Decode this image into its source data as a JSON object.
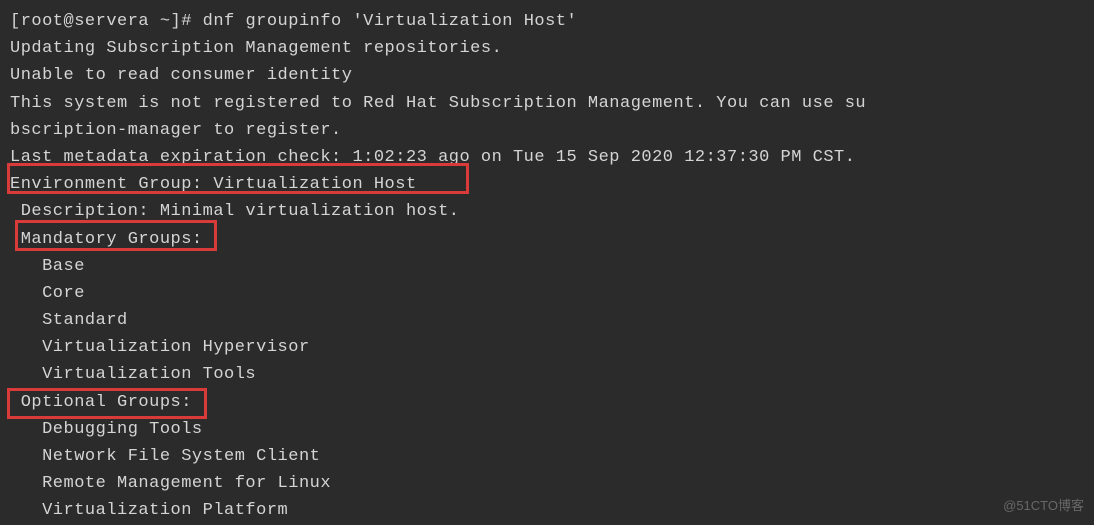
{
  "prompt": {
    "user_host": "[root@servera ~]#",
    "command": " dnf groupinfo 'Virtualization Host'"
  },
  "output": {
    "line1": "Updating Subscription Management repositories.",
    "line2": "Unable to read consumer identity",
    "line3": "This system is not registered to Red Hat Subscription Management. You can use su",
    "line4": "bscription-manager to register.",
    "line5": "Last metadata expiration check: 1:02:23 ago on Tue 15 Sep 2020 12:37:30 PM CST.",
    "env_group": "Environment Group: Virtualization Host",
    "description": " Description: Minimal virtualization host.",
    "mandatory_header": " Mandatory Groups:",
    "mandatory_items": [
      "   Base",
      "   Core",
      "   Standard",
      "   Virtualization Hypervisor",
      "   Virtualization Tools"
    ],
    "optional_header": " Optional Groups:",
    "optional_items": [
      "   Debugging Tools",
      "   Network File System Client",
      "   Remote Management for Linux",
      "   Virtualization Platform"
    ]
  },
  "watermark": "@51CTO博客"
}
